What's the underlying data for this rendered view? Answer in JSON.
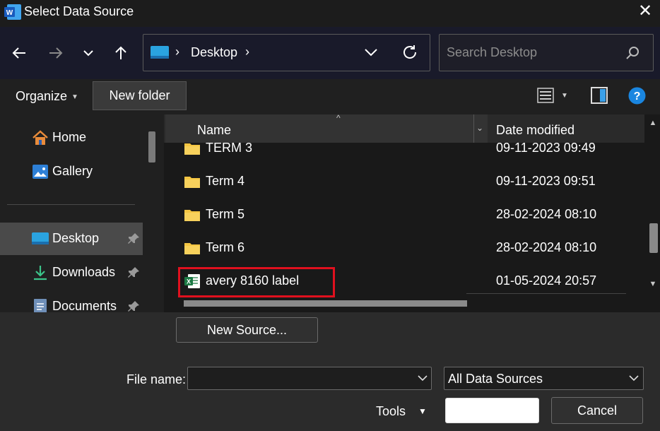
{
  "window": {
    "title": "Select Data Source"
  },
  "address": {
    "location": "Desktop"
  },
  "search": {
    "placeholder": "Search Desktop"
  },
  "toolbar": {
    "organize_label": "Organize",
    "new_folder_label": "New folder"
  },
  "sidebar": {
    "items": [
      {
        "label": "Home",
        "pinned": false,
        "selected": false
      },
      {
        "label": "Gallery",
        "pinned": false,
        "selected": false
      },
      {
        "label": "Desktop",
        "pinned": true,
        "selected": true
      },
      {
        "label": "Downloads",
        "pinned": true,
        "selected": false
      },
      {
        "label": "Documents",
        "pinned": true,
        "selected": false
      }
    ]
  },
  "files": {
    "columns": {
      "name": "Name",
      "date": "Date modified"
    },
    "rows": [
      {
        "name": "TERM 3",
        "type": "folder",
        "date": "09-11-2023 09:49"
      },
      {
        "name": "Term 4",
        "type": "folder",
        "date": "09-11-2023 09:51"
      },
      {
        "name": "Term 5",
        "type": "folder",
        "date": "28-02-2024 08:10"
      },
      {
        "name": "Term 6",
        "type": "folder",
        "date": "28-02-2024 08:10"
      },
      {
        "name": "avery 8160 label",
        "type": "excel",
        "date": "01-05-2024 20:57",
        "highlighted": true
      }
    ]
  },
  "bottom": {
    "new_source_label": "New Source...",
    "file_name_label": "File name:",
    "file_name_value": "",
    "filter_value": "All Data Sources",
    "tools_label": "Tools",
    "open_label": "",
    "cancel_label": "Cancel"
  },
  "colors": {
    "highlight": "#e0101e",
    "accent": "#0078d4",
    "folder": "#f4c542"
  }
}
